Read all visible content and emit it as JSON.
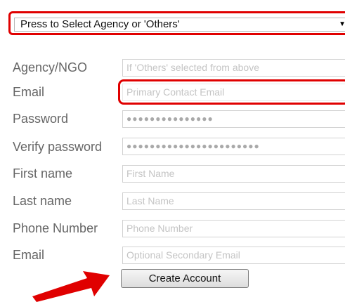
{
  "agency_select": {
    "selected": "Press to Select Agency or 'Others'",
    "caret_icon": "dropdown-caret-icon"
  },
  "form": {
    "rows": [
      {
        "label": "Agency/NGO",
        "placeholder": "If 'Others' selected from above"
      },
      {
        "label": "Email",
        "placeholder": "Primary Contact Email"
      },
      {
        "label": "Password",
        "value": "●●●●●●●●●●●●●●●"
      },
      {
        "label": "Verify password",
        "value": "●●●●●●●●●●●●●●●●●●●●●●●"
      },
      {
        "label": "First name",
        "placeholder": "First Name"
      },
      {
        "label": "Last name",
        "placeholder": "Last Name"
      },
      {
        "label": "Phone Number",
        "placeholder": "Phone Number"
      },
      {
        "label": "Email",
        "placeholder": "Optional Secondary Email"
      }
    ],
    "submit_label": "Create Account"
  },
  "annotations": {
    "highlight_color": "#e00000",
    "arrow_icon": "red-arrow-icon"
  }
}
